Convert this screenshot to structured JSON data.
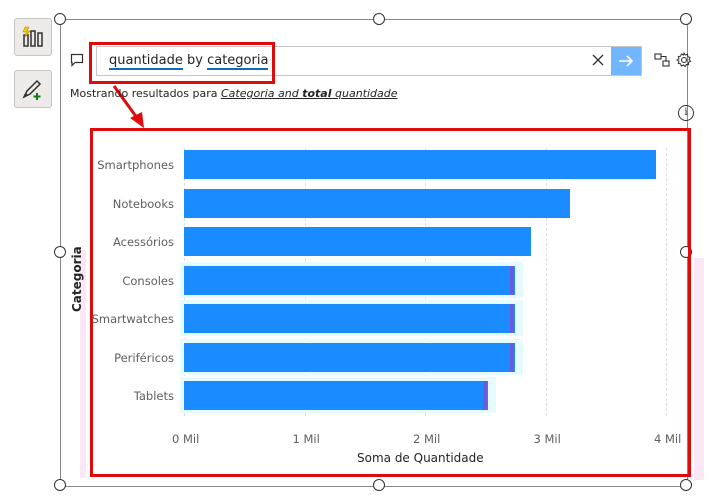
{
  "qa": {
    "query": {
      "w1": "quantidade",
      "w2": " by ",
      "w3": "categoria"
    },
    "restatement": {
      "prefix": "Mostrando resultados para ",
      "part1": "Categoria and ",
      "part2": "total",
      "part3": " quantidade"
    }
  },
  "colors": {
    "accent": "#1a8cff",
    "highlight": "#e00a0a",
    "submit": "#72b6ff"
  },
  "icons": [
    "quick-insights-icon",
    "format-visual-icon",
    "comment-icon",
    "clear-icon",
    "arrow-right-icon",
    "turn-into-visual-icon",
    "settings-icon",
    "info-icon",
    "more-options-icon"
  ],
  "chart_data": {
    "type": "bar",
    "orientation": "horizontal",
    "categories": [
      "Smartphones",
      "Notebooks",
      "Acessórios",
      "Consoles",
      "Smartwatches",
      "Periféricos",
      "Tablets"
    ],
    "values": [
      3.92,
      3.2,
      2.88,
      2.75,
      2.75,
      2.75,
      2.52
    ],
    "xlabel": "Soma de Quantidade",
    "ylabel": "Categoria",
    "xticks": [
      "0 Mil",
      "1 Mil",
      "2 Mil",
      "3 Mil",
      "4 Mil"
    ],
    "xlim": [
      0,
      4
    ],
    "grid": true
  }
}
